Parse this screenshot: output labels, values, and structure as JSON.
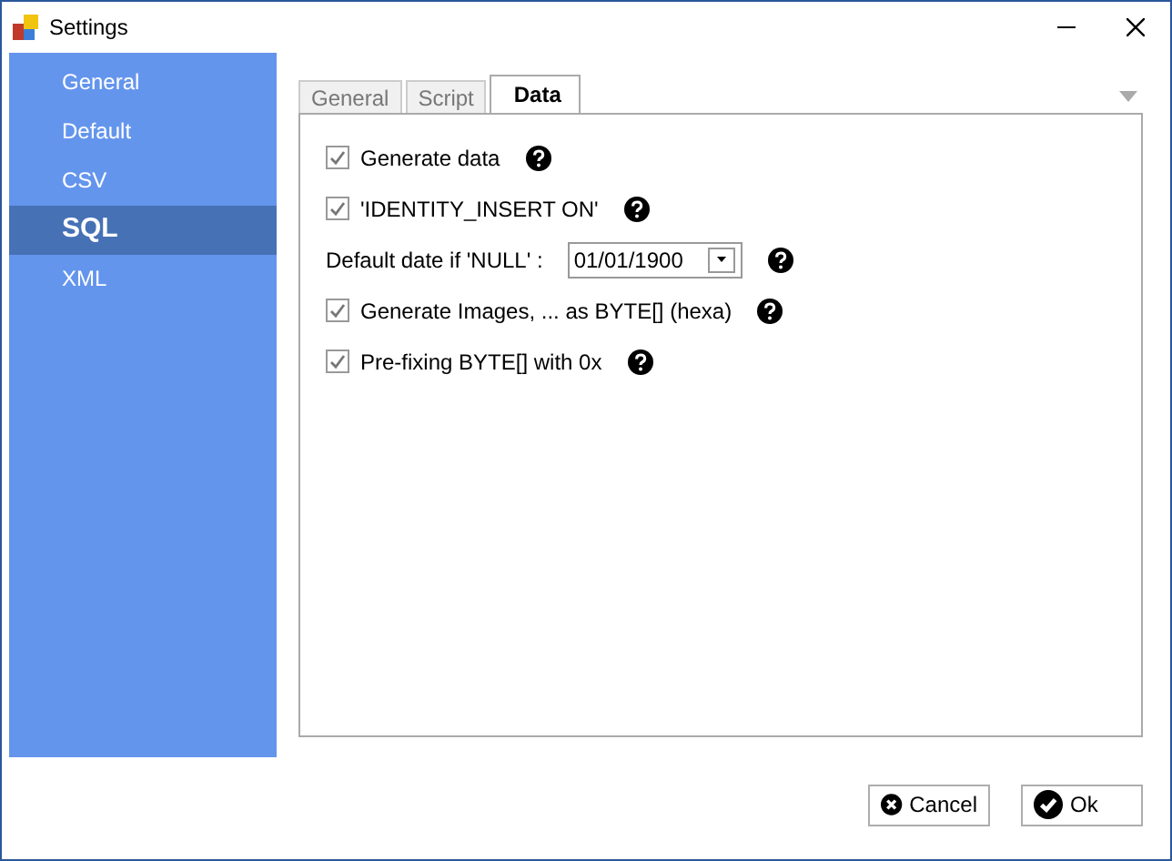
{
  "window": {
    "title": "Settings"
  },
  "sidebar": {
    "items": [
      {
        "label": "General",
        "selected": false
      },
      {
        "label": "Default",
        "selected": false
      },
      {
        "label": "CSV",
        "selected": false
      },
      {
        "label": "SQL",
        "selected": true
      },
      {
        "label": "XML",
        "selected": false
      }
    ]
  },
  "tabs": [
    {
      "label": "General",
      "selected": false
    },
    {
      "label": "Script",
      "selected": false
    },
    {
      "label": "Data",
      "selected": true
    }
  ],
  "options": [
    {
      "kind": "checkbox",
      "label": "Generate data",
      "checked": true
    },
    {
      "kind": "checkbox",
      "label": "'IDENTITY_INSERT ON'",
      "checked": true
    },
    {
      "kind": "date",
      "label": "Default date if 'NULL' :",
      "value": "01/01/1900"
    },
    {
      "kind": "checkbox",
      "label": "Generate Images, ... as BYTE[] (hexa)",
      "checked": true
    },
    {
      "kind": "checkbox",
      "label": "Pre-fixing BYTE[] with 0x",
      "checked": true
    }
  ],
  "buttons": [
    {
      "kind": "cancel",
      "label": "Cancel"
    },
    {
      "kind": "ok",
      "label": "Ok"
    }
  ]
}
